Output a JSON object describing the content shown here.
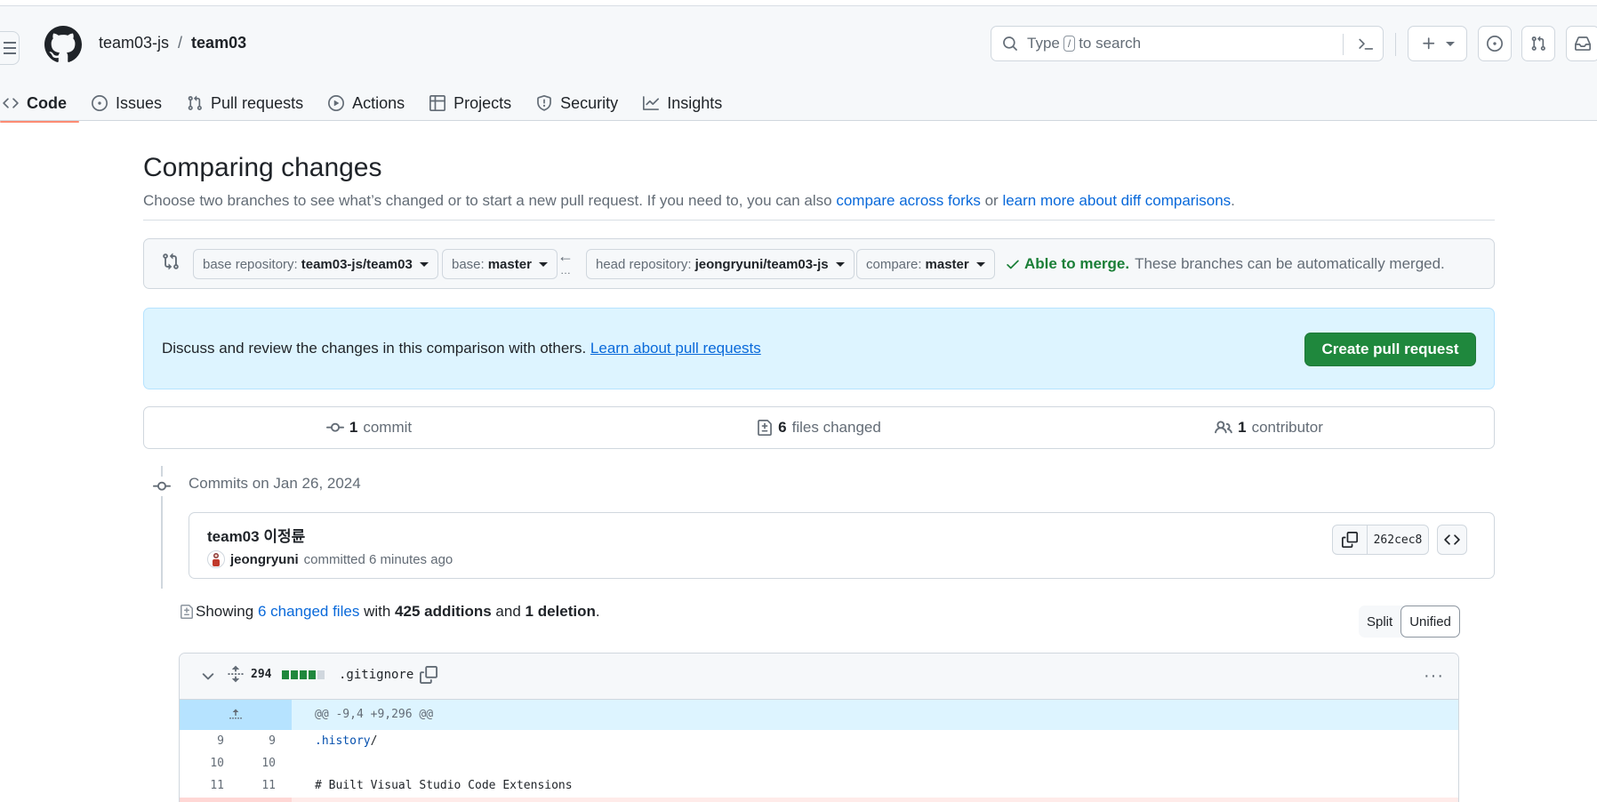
{
  "header": {
    "owner": "team03-js",
    "separator": "/",
    "repo": "team03",
    "search_prefix": "Type",
    "search_key": "/",
    "search_suffix": "to search"
  },
  "nav": {
    "items": [
      {
        "label": "Code",
        "icon": "code-icon"
      },
      {
        "label": "Issues",
        "icon": "issue-opened-icon"
      },
      {
        "label": "Pull requests",
        "icon": "git-pull-request-icon"
      },
      {
        "label": "Actions",
        "icon": "play-icon"
      },
      {
        "label": "Projects",
        "icon": "table-icon"
      },
      {
        "label": "Security",
        "icon": "shield-icon"
      },
      {
        "label": "Insights",
        "icon": "graph-icon"
      }
    ],
    "active": "Code"
  },
  "page": {
    "title": "Comparing changes",
    "subtitle_text": "Choose two branches to see what’s changed or to start a new pull request. If you need to, you can also",
    "subtitle_link1": "compare across forks",
    "subtitle_or": "or",
    "subtitle_link2": "learn more about diff comparisons",
    "subtitle_end": "."
  },
  "range": {
    "base_repo_label": "base repository:",
    "base_repo_value": "team03-js/team03",
    "base_label": "base:",
    "base_value": "master",
    "head_repo_label": "head repository:",
    "head_repo_value": "jeongryuni/team03-js",
    "compare_label": "compare:",
    "compare_value": "master",
    "merge_ok": "Able to merge.",
    "merge_text": "These branches can be automatically merged."
  },
  "flash": {
    "text": "Discuss and review the changes in this comparison with others.",
    "link": "Learn about pull requests",
    "button": "Create pull request"
  },
  "summary": {
    "commits_count": "1",
    "commits_label": "commit",
    "files_count": "6",
    "files_label": "files changed",
    "contributors_count": "1",
    "contributors_label": "contributor"
  },
  "commits": {
    "heading": "Commits on Jan 26, 2024",
    "items": [
      {
        "title": "team03 이정륜",
        "author": "jeongryuni",
        "meta": "committed 6 minutes ago",
        "sha": "262cec8"
      }
    ]
  },
  "diffstat": {
    "showing": "Showing",
    "changed_files": "6 changed files",
    "with": "with",
    "additions": "425 additions",
    "and": "and",
    "deletions": "1 deletion",
    "end": ".",
    "split_label": "Split",
    "unified_label": "Unified",
    "selected_view": "Unified"
  },
  "file": {
    "change_count": "294",
    "name": ".gitignore",
    "hunk": "@@ -9,4 +9,296 @@",
    "lines": [
      {
        "old": "9",
        "new": "9",
        "code_hl": ".history",
        "code_rest": "/"
      },
      {
        "old": "10",
        "new": "10",
        "code_hl": "",
        "code_rest": ""
      },
      {
        "old": "11",
        "new": "11",
        "code_hl": "",
        "code_rest": "# Built Visual Studio Code Extensions"
      }
    ]
  },
  "colors": {
    "accent": "#0969da",
    "success": "#1a7f37",
    "primary_button": "#1f883d",
    "active_tab_underline": "#fd8c73",
    "flash_bg": "#ddf4ff"
  }
}
